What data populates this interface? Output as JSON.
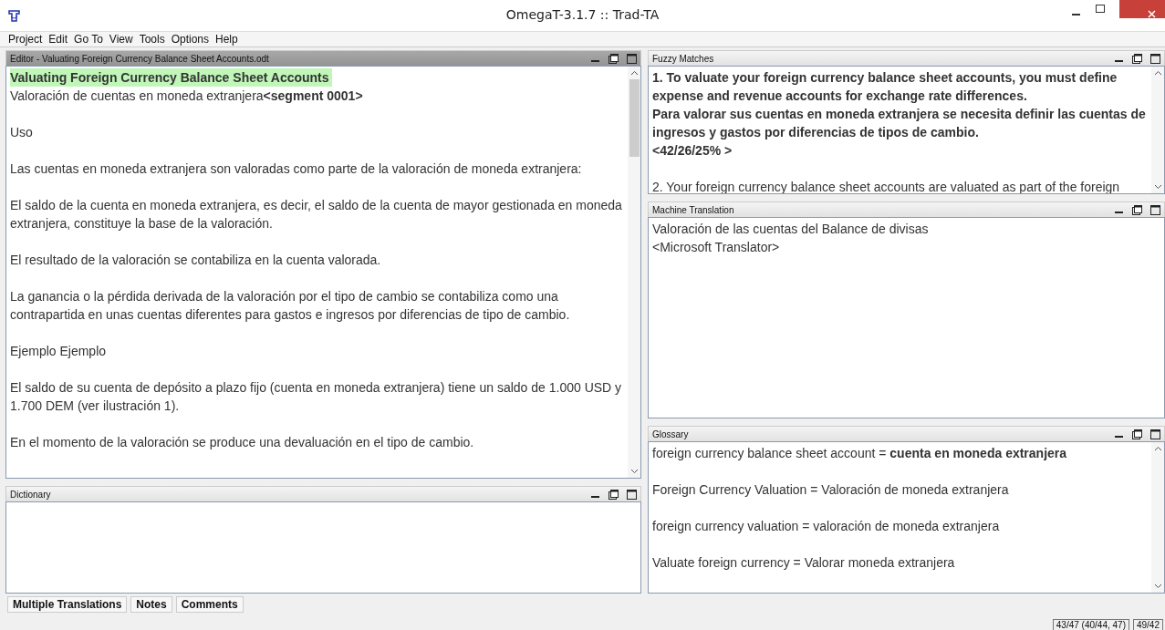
{
  "window": {
    "title": "OmegaT-3.1.7 :: Trad-TA"
  },
  "menu": [
    "Project",
    "Edit",
    "Go To",
    "View",
    "Tools",
    "Options",
    "Help"
  ],
  "editor": {
    "title": "Editor - Valuating Foreign Currency Balance Sheet Accounts.odt",
    "active_segment": {
      "source": "Valuating Foreign Currency Balance Sheet Accounts",
      "target": "Valoración de cuentas en moneda extranjera**<segment 0001>**"
    },
    "paragraphs": [
      "Uso",
      "Las cuentas en moneda extranjera son valoradas como parte de la valoración de moneda extranjera:",
      "El saldo de la cuenta en moneda extranjera, es decir, el saldo de la cuenta de mayor gestionada en moneda extranjera, constituye la base de la valoración.",
      "El resultado de la valoración se contabiliza en la cuenta valorada.",
      "La ganancia o la pérdida derivada de la valoración por el tipo de cambio se contabiliza como una contrapartida en unas cuentas diferentes para gastos e ingresos por diferencias de tipo de cambio.",
      "Ejemplo Ejemplo",
      "El saldo de su cuenta de depósito a plazo fijo (cuenta en moneda extranjera) tiene un saldo de 1.000 USD y 1.700 DEM (ver ilustración 1).",
      "En el momento de la valoración se produce una devaluación en el tipo de cambio."
    ]
  },
  "dictionary": {
    "title": "Dictionary"
  },
  "fuzzy_matches": {
    "title": "Fuzzy Matches",
    "matches": [
      {
        "selected": true,
        "text": "1. To valuate your foreign currency balance sheet accounts, you must define expense and revenue accounts for exchange rate differences.\nPara valorar sus cuentas en moneda extranjera se necesita definir las cuentas de ingresos y gastos por diferencias de tipos de cambio.\n<42/26/25% >"
      },
      {
        "selected": false,
        "text": "2. Your foreign currency balance sheet accounts are valuated as part of the foreign"
      }
    ]
  },
  "machine_translation": {
    "title": "Machine Translation",
    "text": "Valoración de las cuentas del Balance de divisas",
    "provider": "<Microsoft Translator>"
  },
  "glossary": {
    "title": "Glossary",
    "entries": [
      "foreign currency balance sheet account = **cuenta en moneda extranjera**",
      "Foreign Currency Valuation = Valoración de moneda extranjera",
      "foreign currency valuation = valoración de moneda extranjera",
      "Valuate foreign currency = Valorar moneda extranjera"
    ]
  },
  "bottom_tabs": [
    "Multiple Translations",
    "Notes",
    "Comments"
  ],
  "status_bar": [
    "43/47 (40/44, 47)",
    "49/42"
  ]
}
